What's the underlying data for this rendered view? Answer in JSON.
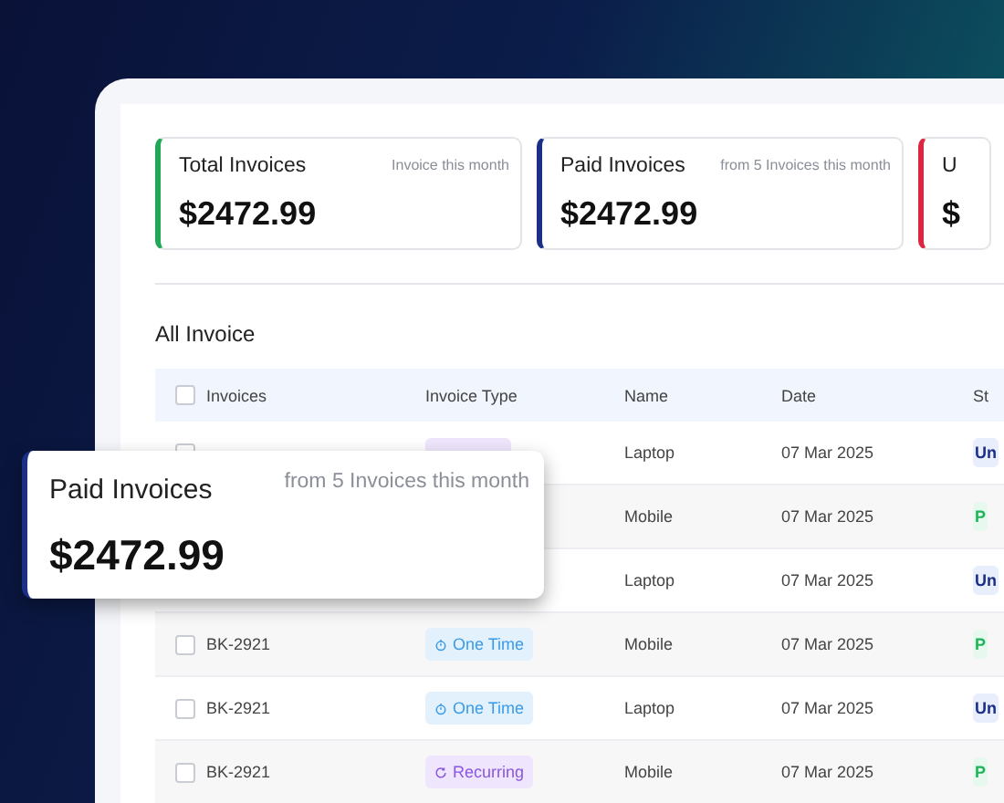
{
  "cards": [
    {
      "title": "Total Invoices",
      "subtitle": "Invoice this month",
      "amount": "$2472.99",
      "color": "#1fa855"
    },
    {
      "title": "Paid Invoices",
      "subtitle": "from 5 Invoices this month",
      "amount": "$2472.99",
      "color": "#1b2f86"
    },
    {
      "title": "U",
      "amount": "$",
      "color": "#dc2743"
    }
  ],
  "section_title": "All Invoice",
  "table": {
    "header_checked": false,
    "columns": [
      "Invoices",
      "Invoice Type",
      "Name",
      "Date",
      "St"
    ],
    "rows": [
      {
        "checked": false,
        "type": {
          "kind": "recurring"
        },
        "name": "Laptop",
        "date": "07 Mar 2025",
        "status": {
          "label": "Un",
          "kind": "unpaid"
        }
      },
      {
        "name": "Mobile",
        "date": "07 Mar 2025",
        "status": {
          "label": "P",
          "kind": "paid"
        }
      },
      {
        "name": "Laptop",
        "date": "07 Mar 2025",
        "status": {
          "label": "Un",
          "kind": "unpaid"
        }
      },
      {
        "checked": false,
        "invoice": "BK-2921",
        "type": {
          "kind": "onetime",
          "label": "One Time"
        },
        "name": "Mobile",
        "date": "07 Mar 2025",
        "status": {
          "label": "P",
          "kind": "paid"
        }
      },
      {
        "checked": false,
        "invoice": "BK-2921",
        "type": {
          "kind": "onetime",
          "label": "One Time"
        },
        "name": "Laptop",
        "date": "07 Mar 2025",
        "status": {
          "label": "Un",
          "kind": "unpaid"
        }
      },
      {
        "checked": false,
        "invoice": "BK-2921",
        "type": {
          "kind": "recurring",
          "label": "Recurring"
        },
        "name": "Mobile",
        "date": "07 Mar 2025",
        "status": {
          "label": "P",
          "kind": "paid"
        }
      }
    ]
  },
  "popup": {
    "title": "Paid Invoices",
    "subtitle": "from 5 Invoices this month",
    "amount": "$2472.99",
    "color": "#1b2f86"
  }
}
